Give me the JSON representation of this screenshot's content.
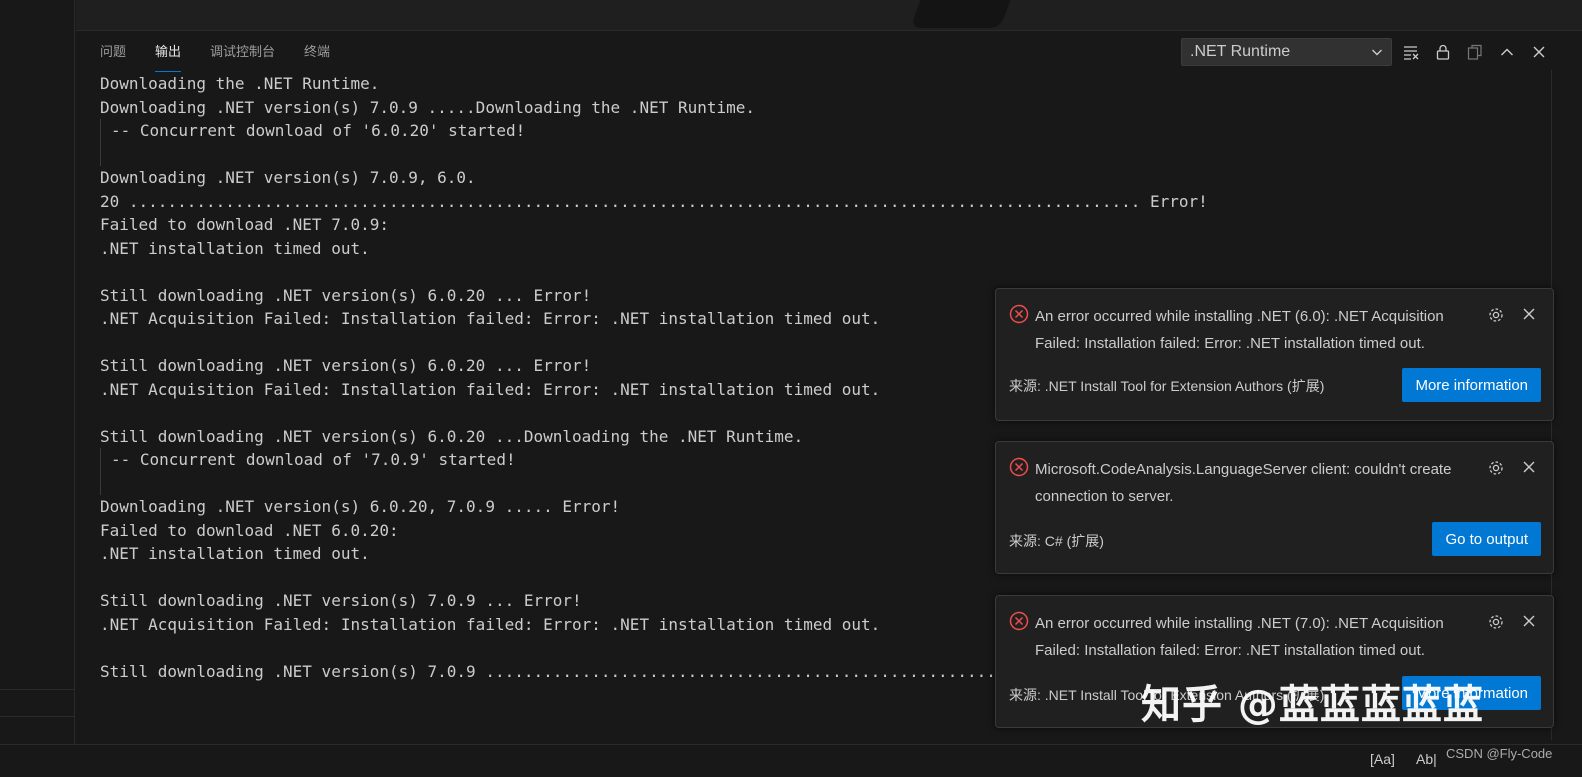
{
  "panel": {
    "tabs": [
      {
        "label": "问题"
      },
      {
        "label": "输出"
      },
      {
        "label": "调试控制台"
      },
      {
        "label": "终端"
      }
    ],
    "active_tab": "输出",
    "channel": ".NET Runtime"
  },
  "output": {
    "lines": [
      "Downloading the .NET Runtime.",
      "Downloading .NET version(s) 7.0.9 .....Downloading the .NET Runtime.",
      "-- Concurrent download of '6.0.20' started!",
      "",
      "Downloading .NET version(s) 7.0.9, 6.0.",
      "20 ......................................................................................................... Error!",
      "Failed to download .NET 7.0.9:",
      ".NET installation timed out.",
      "",
      "Still downloading .NET version(s) 6.0.20 ... Error!",
      ".NET Acquisition Failed: Installation failed: Error: .NET installation timed out.",
      "",
      "Still downloading .NET version(s) 6.0.20 ... Error!",
      ".NET Acquisition Failed: Installation failed: Error: .NET installation timed out.",
      "",
      "Still downloading .NET version(s) 6.0.20 ...Downloading the .NET Runtime.",
      "-- Concurrent download of '7.0.9' started!",
      "",
      "Downloading .NET version(s) 6.0.20, 7.0.9 ..... Error!",
      "Failed to download .NET 6.0.20:",
      ".NET installation timed out.",
      "",
      "Still downloading .NET version(s) 7.0.9 ... Error!",
      ".NET Acquisition Failed: Installation failed: Error: .NET installation timed out.",
      "",
      "Still downloading .NET version(s) 7.0.9 ......................................................................"
    ]
  },
  "notifications": [
    {
      "message": "An error occurred while installing .NET (6.0): .NET Acquisition Failed: Installation failed: Error: .NET installation timed out.",
      "source": "来源: .NET Install Tool for Extension Authors (扩展)",
      "button": "More information"
    },
    {
      "message": "Microsoft.CodeAnalysis.LanguageServer client: couldn't create connection to server.",
      "source": "来源: C# (扩展)",
      "button": "Go to output"
    },
    {
      "message": "An error occurred while installing .NET (7.0): .NET Acquisition Failed: Installation failed: Error: .NET installation timed out.",
      "source": "来源: .NET Install Tool for Extension Authors (扩展)",
      "button": "More information"
    }
  ],
  "statusbar": {
    "match_case": "[Aa]",
    "match_word": "Ab|"
  },
  "watermarks": {
    "zhihu": "知乎 @蓝蓝蓝蓝蓝",
    "csdn": "CSDN @Fly-Code"
  },
  "colors": {
    "background": "#181818",
    "accent": "#0078d4",
    "error": "#f14c4c",
    "text": "#cccccc"
  },
  "icons": [
    "chevron-down-icon",
    "clear-output-icon",
    "lock-icon",
    "copy-icon",
    "chevron-up-icon",
    "close-icon",
    "error-icon",
    "gear-icon"
  ]
}
